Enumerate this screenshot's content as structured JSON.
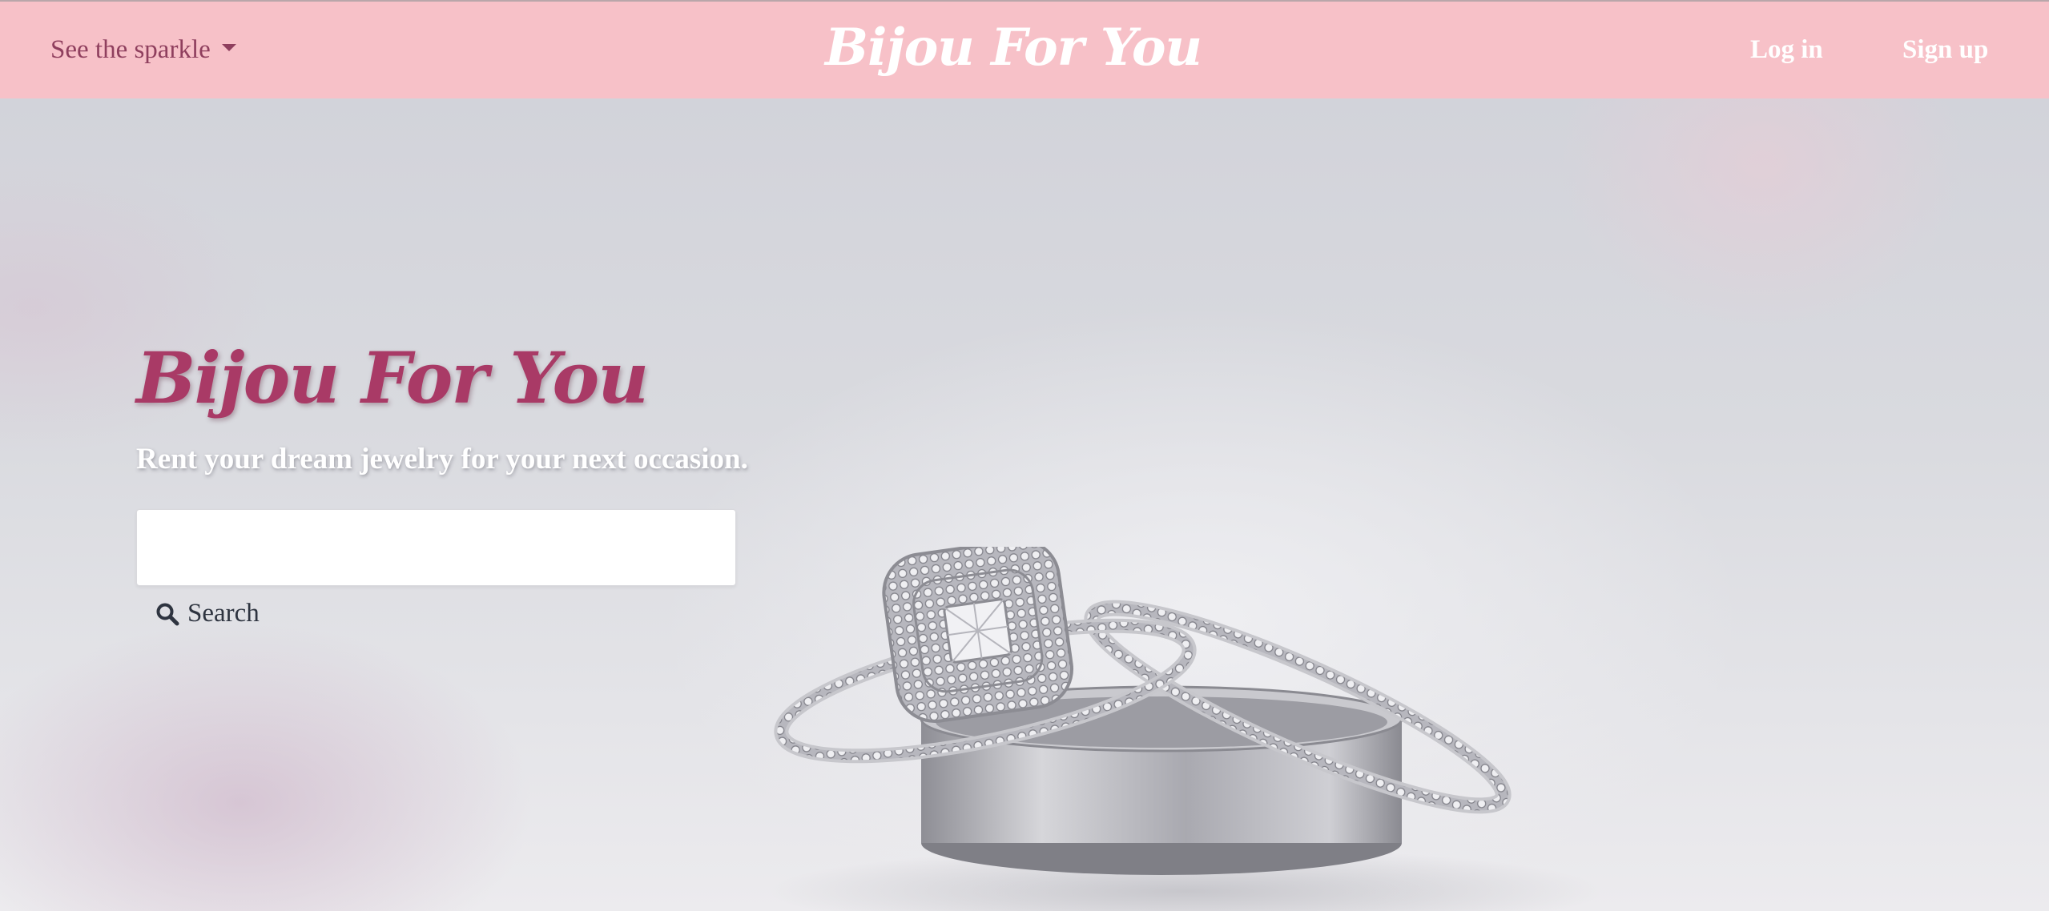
{
  "navbar": {
    "dropdown_label": "See the sparkle",
    "brand": "Bijou For You",
    "login_label": "Log in",
    "signup_label": "Sign up"
  },
  "hero": {
    "title": "Bijou For You",
    "tagline": "Rent your dream jewelry for your next occasion.",
    "search": {
      "value": "",
      "placeholder": "",
      "button_label": "Search"
    }
  },
  "colors": {
    "navbar_bg": "#f7c1c8",
    "dropdown_text": "#8f3f5e",
    "hero_title": "#a93a66",
    "white": "#ffffff"
  },
  "icons": {
    "dropdown": "caret-down-icon",
    "search": "magnifier-icon"
  }
}
